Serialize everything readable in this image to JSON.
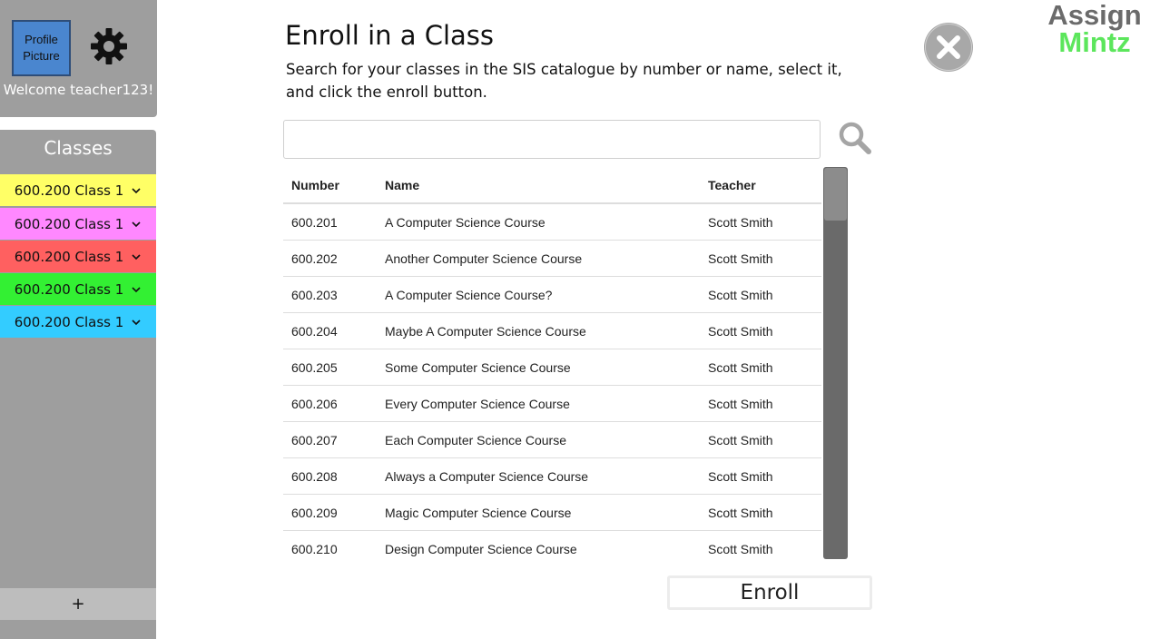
{
  "profile": {
    "picture_label": "Profile Picture",
    "welcome": "Welcome teacher123!"
  },
  "sidebar": {
    "title": "Classes",
    "items": [
      {
        "label": "600.200 Class 1",
        "color": "#ffff66"
      },
      {
        "label": "600.200 Class 1",
        "color": "#ff88ff"
      },
      {
        "label": "600.200 Class 1",
        "color": "#ff6060"
      },
      {
        "label": "600.200 Class 1",
        "color": "#33f033"
      },
      {
        "label": "600.200 Class 1",
        "color": "#33ccff"
      }
    ],
    "add_label": "+"
  },
  "dialog": {
    "title": "Enroll in a Class",
    "description": "Search for your classes in the SIS catalogue by number or name, select it, and click the enroll button.",
    "search": {
      "value": "",
      "placeholder": ""
    },
    "enroll_label": "Enroll"
  },
  "logo": {
    "line1": "Assign",
    "line2": "Mintz",
    "color1": "#6b6b6b",
    "color2": "#5ce65c"
  },
  "table": {
    "headers": [
      "Number",
      "Name",
      "Teacher"
    ],
    "rows": [
      [
        "600.201",
        "A Computer Science Course",
        "Scott Smith"
      ],
      [
        "600.202",
        "Another Computer Science Course",
        "Scott Smith"
      ],
      [
        "600.203",
        "A Computer Science Course?",
        "Scott Smith"
      ],
      [
        "600.204",
        "Maybe A Computer Science Course",
        "Scott Smith"
      ],
      [
        "600.205",
        "Some Computer Science Course",
        "Scott Smith"
      ],
      [
        "600.206",
        "Every Computer Science Course",
        "Scott Smith"
      ],
      [
        "600.207",
        "Each Computer Science Course",
        "Scott Smith"
      ],
      [
        "600.208",
        "Always a Computer Science Course",
        "Scott Smith"
      ],
      [
        "600.209",
        "Magic Computer Science Course",
        "Scott Smith"
      ],
      [
        "600.210",
        "Design Computer Science Course",
        "Scott Smith"
      ]
    ]
  },
  "icons": {
    "settings": "gear-icon",
    "close": "close-icon",
    "search": "search-icon",
    "dropdown": "chevron-down-icon"
  }
}
